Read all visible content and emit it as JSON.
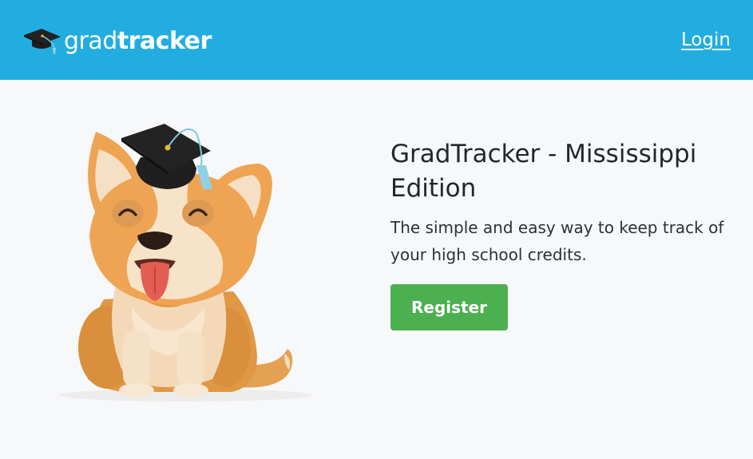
{
  "header": {
    "brand": {
      "light": "grad",
      "bold": "tracker",
      "logo_icon": "graduation-cap-icon"
    },
    "login_label": "Login"
  },
  "hero": {
    "title": "GradTracker - Mississippi Edition",
    "subtitle": "The simple and easy way to keep track of your high school credits.",
    "register_label": "Register",
    "illustration": "corgi-with-graduation-cap"
  },
  "colors": {
    "header_bg": "#21ade0",
    "page_bg": "#f7f8fa",
    "button_bg": "#4caf50",
    "title_text": "#22272c"
  }
}
